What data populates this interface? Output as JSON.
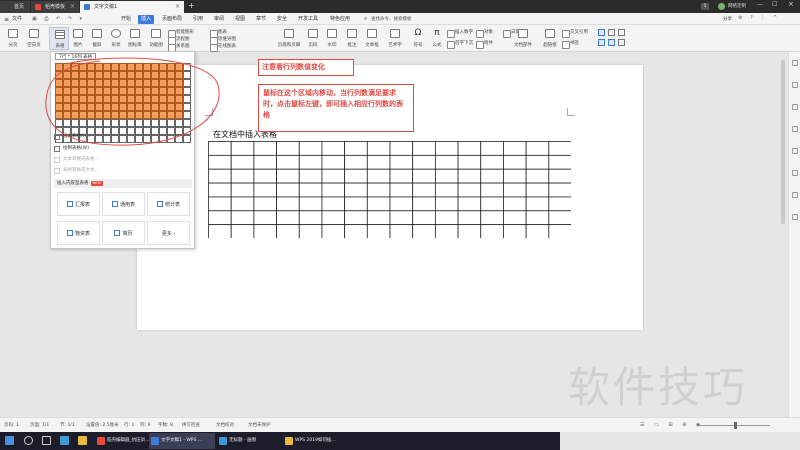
{
  "tabs": [
    {
      "label": "首页",
      "active": false
    },
    {
      "label": "稻壳模板",
      "active": false
    },
    {
      "label": "文字文稿1",
      "active": true
    }
  ],
  "titlebar": {
    "badge": "1",
    "user": "网络定制"
  },
  "menus": [
    "文件",
    "开始",
    "插入",
    "页面布局",
    "引用",
    "审阅",
    "视图",
    "章节",
    "安全",
    "开发工具",
    "特色应用"
  ],
  "active_menu": "插入",
  "search_placeholder": "查找命令、搜索模板",
  "share_label": "分享",
  "ribbon": {
    "big": [
      "分页",
      "空白页",
      "表格",
      "图片",
      "截屏",
      "形状",
      "图标库",
      "功能图",
      "页眉和页脚",
      "页码",
      "水印",
      "批注",
      "文本框",
      "艺术字",
      "符号",
      "公式",
      "对象",
      "文档部件",
      "超链接",
      "交叉引用",
      "书签"
    ],
    "small": [
      "智能图形",
      "图表",
      "思维导图",
      "流程图",
      "关系图",
      "在线图表",
      "插入数字",
      "对象",
      "日期",
      "首字下沉",
      "附件"
    ]
  },
  "dropdown": {
    "grid_label": "7行 * 16列 表格",
    "grid_rows": 10,
    "grid_cols": 17,
    "selected_rows": 7,
    "selected_cols": 16,
    "items": [
      {
        "label": "插入表格(I)...",
        "enabled": true
      },
      {
        "label": "绘制表格(W)",
        "enabled": true
      },
      {
        "label": "文本转换成表格...",
        "enabled": false
      },
      {
        "label": "表格转换成文本...",
        "enabled": false
      }
    ],
    "section_label": "插入内容型表格",
    "section_badge": "NEW",
    "cards": [
      "汇报表",
      "通用表",
      "统计表",
      "物资表",
      "简历",
      "更多"
    ]
  },
  "annotations": {
    "note1": "注意看行列数值变化",
    "note2": "鼠标在这个区域内移动，当行列数满足要求时，点击鼠标左键，即可插入相应行列数的表格"
  },
  "document": {
    "text": "在文档中插入表格",
    "table_rows": 7,
    "table_cols": 16
  },
  "status": {
    "page_num": "页码: 1",
    "pages": "页面: 1/1",
    "section": "节: 1/1",
    "setting": "设置值: 2.5厘米",
    "row": "行: 1",
    "col": "列: 9",
    "words": "字数: 8",
    "spell": "拼写检查",
    "doc_check": "文档校对",
    "protect": "文档未保护"
  },
  "taskbar": [
    {
      "label": "稻壳编辑器_抗压训...",
      "color": "#e8483a"
    },
    {
      "label": "文字文稿1 - WPS ...",
      "color": "#3c7cd7",
      "active": true
    },
    {
      "label": "无标题 - 画图",
      "color": "#3c9ad7"
    },
    {
      "label": "WPS 2019如何插...",
      "color": "#e8b93a"
    }
  ],
  "watermark": "软件技巧",
  "colors": {
    "accent": "#3c7cd7",
    "annotation": "#e14b46",
    "grid_selected": "#f19e5c"
  }
}
